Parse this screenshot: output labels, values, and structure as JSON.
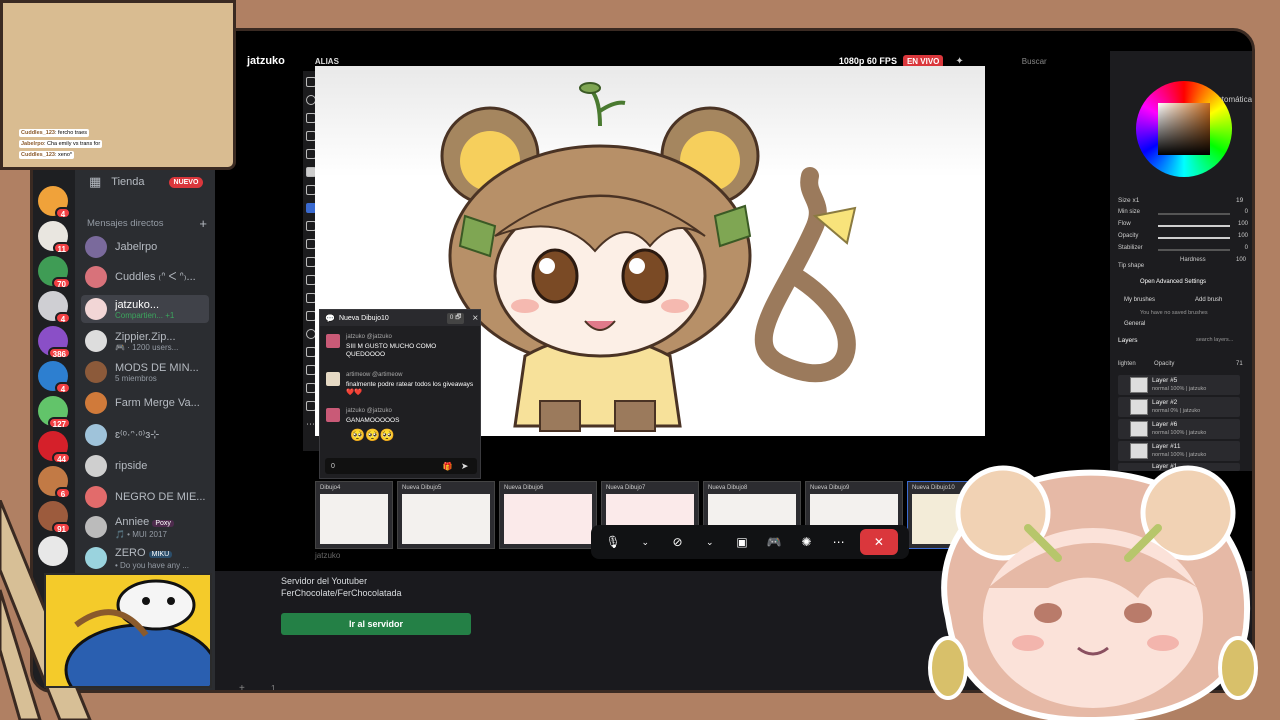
{
  "server_rail": {
    "badges": [
      "4",
      "11",
      "70",
      "4",
      "386",
      "4",
      "127",
      "44",
      "6",
      "91"
    ]
  },
  "dm_panel": {
    "shop_label": "Tienda",
    "shop_badge": "NUEVO",
    "direct_messages_label": "Mensajes directos",
    "add_icon": "+",
    "collapse_icon": "⌄",
    "items": [
      {
        "name": "Jabelrpo",
        "sub": ""
      },
      {
        "name": "Cuddles ₍ᐢ ᐸ ᐢ₎...",
        "sub": ""
      },
      {
        "name": "jatzuko...",
        "sub": "Compartien...  +1"
      },
      {
        "name": "Zippier.Zip...",
        "sub": "🎮 · 1200 users..."
      },
      {
        "name": "MODS DE MIN...",
        "sub": "5 miembros"
      },
      {
        "name": "Farm Merge Va...",
        "sub": ""
      },
      {
        "name": "ɛ⁽ᵒ·ᵔ·ᵒ⁾ɜ⊹",
        "sub": ""
      },
      {
        "name": "ripside",
        "sub": ""
      },
      {
        "name": "NEGRO DE MIE...",
        "sub": ""
      },
      {
        "name": "Anniee",
        "sub": "",
        "tag": "Poxy"
      },
      {
        "name": "ZERO",
        "sub": "• Do you have any ...",
        "tag": "MIKU"
      }
    ],
    "muiu_line": "🎵 • MUI 2017"
  },
  "stream_header": {
    "streamer": "jatzuko",
    "alias": "ALIAS",
    "quality": "1080p 60 FPS",
    "live_badge": "EN VIVO",
    "search_placeholder": "Buscar",
    "blend": "Automática"
  },
  "drawing_app": {
    "size_label": "Size x1",
    "sliders": [
      {
        "label": "Min size",
        "value": "0",
        "fraction": 0
      },
      {
        "label": "Flow",
        "value": "100",
        "fraction": 1
      },
      {
        "label": "Opacity",
        "value": "100",
        "fraction": 1
      },
      {
        "label": "Stabilizer",
        "value": "0",
        "fraction": 0
      }
    ],
    "size_value": "19",
    "tip_shape": "Tip shape",
    "hardness_label": "Hardness",
    "hardness_value": "100",
    "advanced_settings": "Open Advanced Settings",
    "my_brushes": "My brushes",
    "add_brush": "Add brush",
    "no_brushes": "You have no saved brushes",
    "general": "General",
    "layers_title": "Layers",
    "search_layers": "search layers...",
    "lighten": "lighten",
    "opacity_label": "Opacity",
    "opacity_value": "71",
    "layers": [
      {
        "name": "Layer #5",
        "sub": "normal 100% | jatzuko"
      },
      {
        "name": "Layer #2",
        "sub": "normal 0% | jatzuko"
      },
      {
        "name": "Layer #6",
        "sub": "normal 100% | jatzuko"
      },
      {
        "name": "Layer #11",
        "sub": "normal 100% | jatzuko"
      },
      {
        "name": "Layer #1",
        "sub": ""
      }
    ]
  },
  "chat": {
    "title": "Nueva Dibujo10",
    "count": "0 🗗",
    "close": "×",
    "messages": [
      {
        "user": "jatzuko @jatzuko",
        "text": "SIII M GUSTO MUCHO COMO QUEDOOOO"
      },
      {
        "user": "artimeow @artimeow",
        "text": "finalmente podre ratear todos los giveaways ❤️❤️"
      },
      {
        "user": "jatzuko @jatzuko",
        "text": "GANAMOOOOOS"
      }
    ],
    "emojis": "🥺🥺🥺",
    "input_value": "0"
  },
  "thumbnails": [
    "Dibujo4",
    "Nueva Dibujo5",
    "Nueva Dibujo6",
    "Nueva Dibujo7",
    "Nueva Dibujo8",
    "Nueva Dibujo9",
    "Nueva Dibujo10"
  ],
  "stream_footer_name": "jatzuko",
  "server_card": {
    "description": "Servidor del Youtuber FerChocolate/FerChocolatada",
    "join_label": "Ir al servidor"
  },
  "overlay_chat": [
    {
      "user": "Cuddles_123",
      "text": ": fercho traes"
    },
    {
      "user": "Jabelrpo",
      "text": ": Cha emily vs trans for"
    },
    {
      "user": "Cuddles_123",
      "text": ": xeno*"
    }
  ],
  "bottom_bar": {
    "plus": "+",
    "count": "1"
  },
  "colors": {
    "background": "#b08063",
    "discord_dark": "#2b2d31",
    "live_red": "#da373c",
    "join_green": "#248046",
    "overlay_tan": "#d9bc91"
  }
}
